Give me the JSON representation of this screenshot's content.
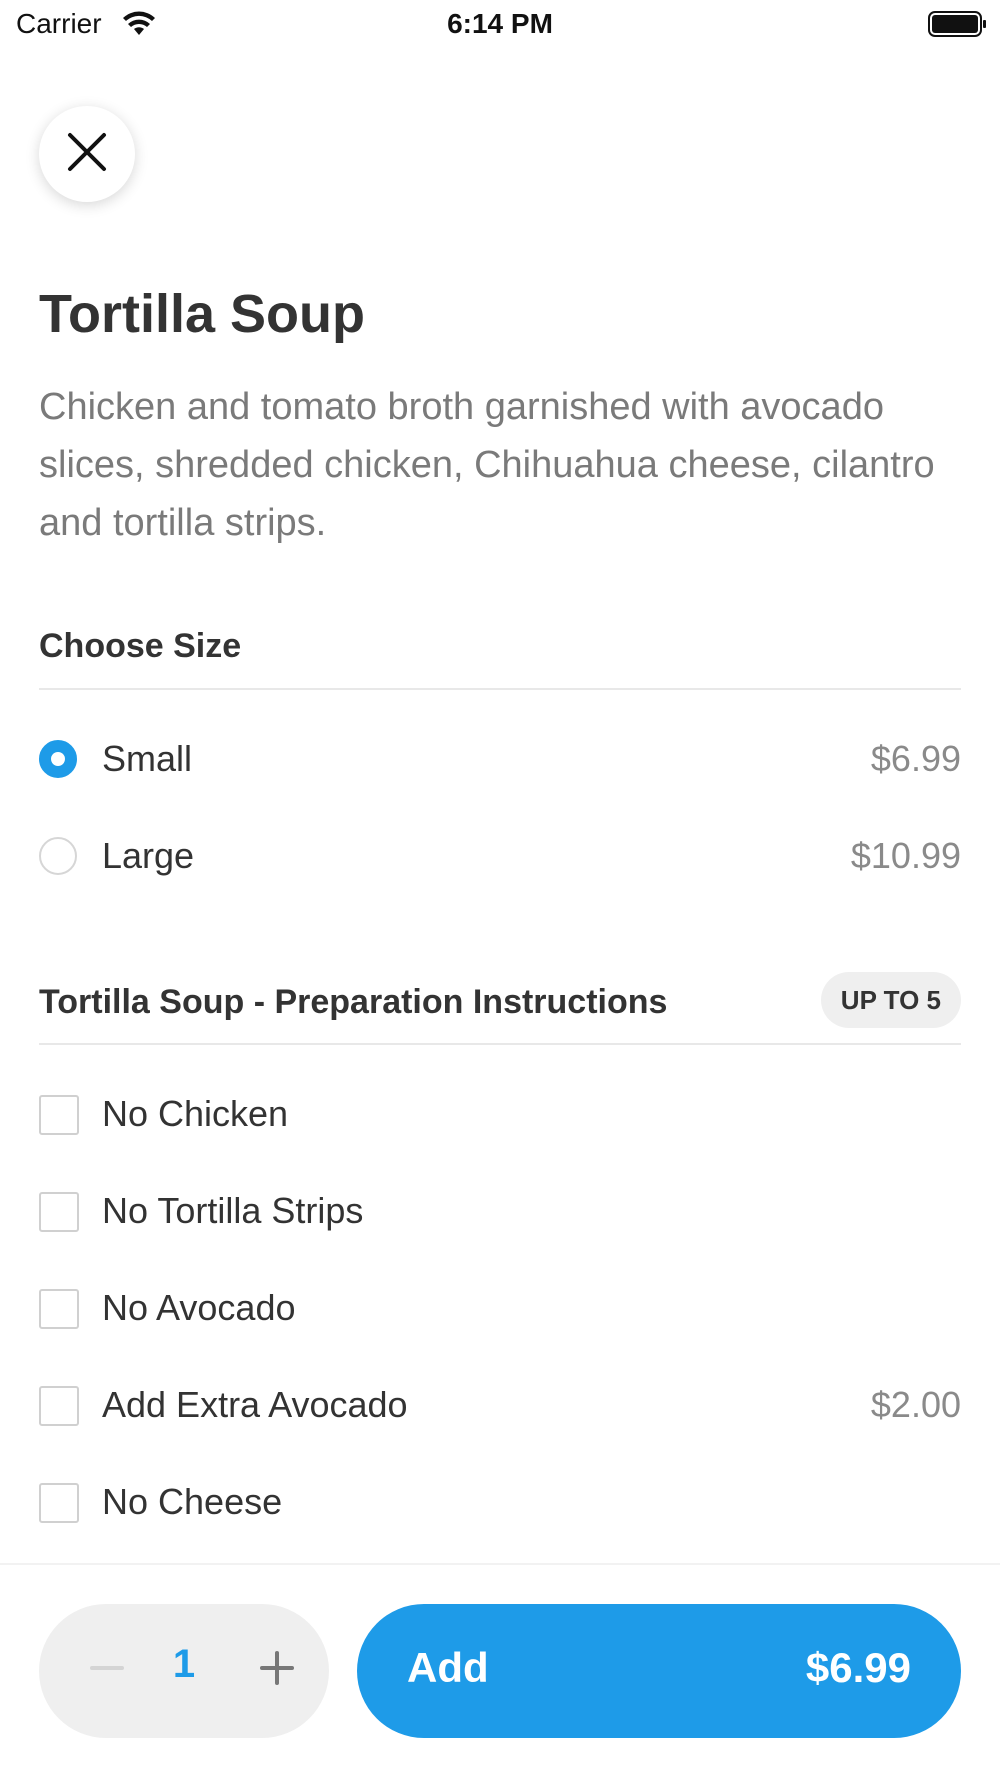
{
  "status_bar": {
    "carrier": "Carrier",
    "time": "6:14 PM"
  },
  "item": {
    "title": "Tortilla Soup",
    "description": "Chicken and tomato broth garnished with avocado slices, shredded chicken, Chihuahua cheese, cilantro and tortilla strips."
  },
  "size_section": {
    "title": "Choose Size",
    "options": [
      {
        "label": "Small",
        "price": "$6.99",
        "selected": true
      },
      {
        "label": "Large",
        "price": "$10.99",
        "selected": false
      }
    ]
  },
  "prep_section": {
    "title": "Tortilla Soup - Preparation Instructions",
    "badge": "UP TO 5",
    "options": [
      {
        "label": "No Chicken",
        "price": ""
      },
      {
        "label": "No Tortilla Strips",
        "price": ""
      },
      {
        "label": "No Avocado",
        "price": ""
      },
      {
        "label": "Add Extra Avocado",
        "price": "$2.00"
      },
      {
        "label": "No Cheese",
        "price": ""
      }
    ]
  },
  "footer": {
    "quantity": "1",
    "add_label": "Add",
    "add_price": "$6.99"
  },
  "colors": {
    "accent": "#1e9be8",
    "text": "#333333",
    "muted": "#7a7a7a"
  },
  "icons": [
    "wifi-icon",
    "battery-icon",
    "close-icon",
    "minus-icon",
    "plus-icon"
  ]
}
